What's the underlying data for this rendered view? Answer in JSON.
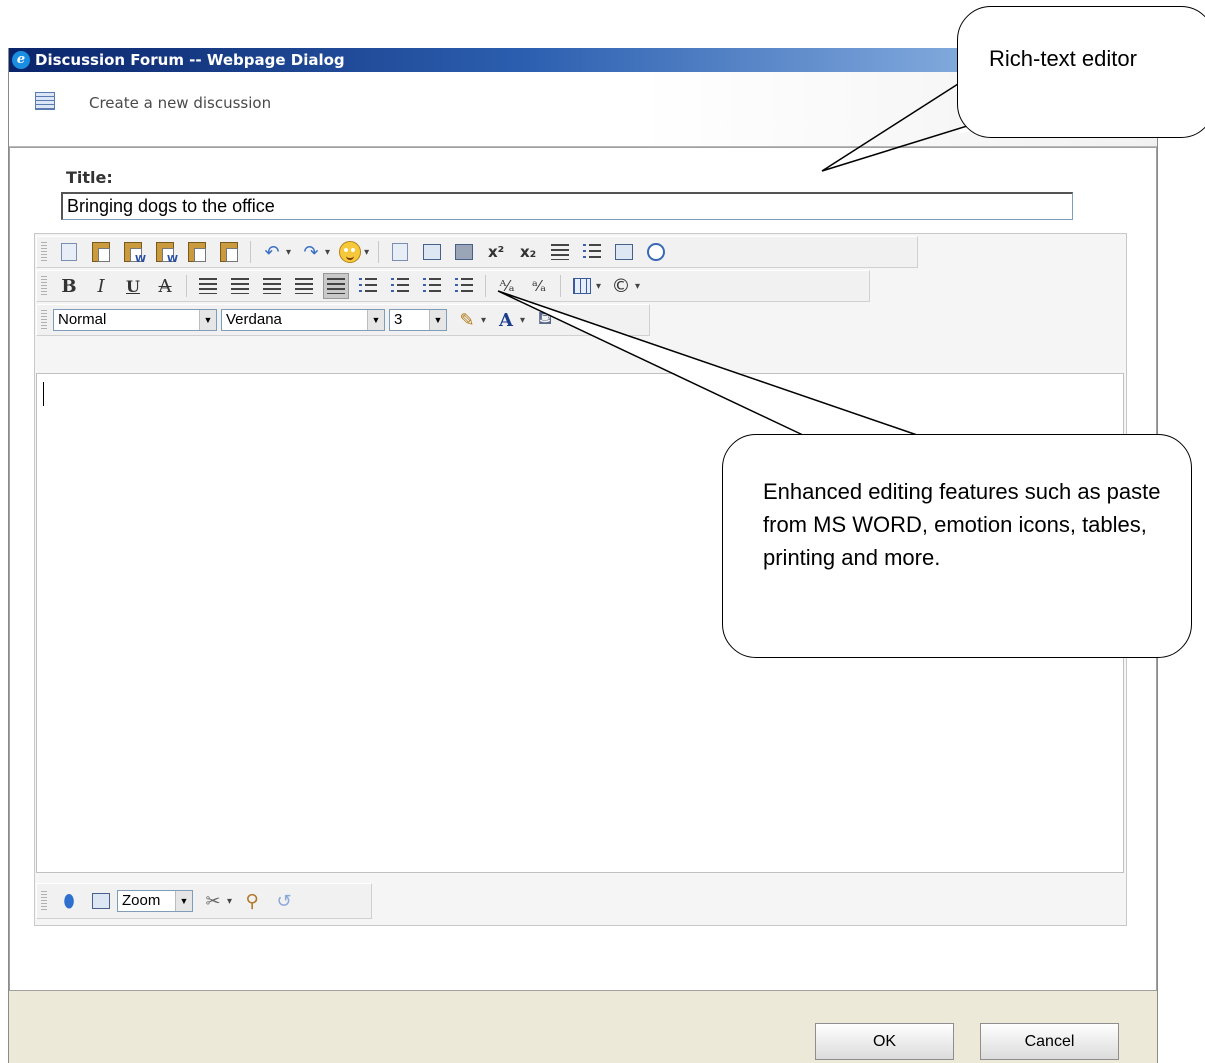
{
  "window": {
    "title": "Discussion Forum -- Webpage Dialog",
    "subheader": "Create a new discussion"
  },
  "form": {
    "title_label": "Title:",
    "title_value": "Bringing dogs to the office"
  },
  "toolbar": {
    "format_select": "Normal",
    "font_select": "Verdana",
    "size_select": "3",
    "zoom_select": "Zoom",
    "bold": "B",
    "italic": "I",
    "underline": "U",
    "strike": "A",
    "font_color": "A",
    "superscript": "x²",
    "subscript": "x₂"
  },
  "buttons": {
    "ok": "OK",
    "cancel": "Cancel"
  },
  "callouts": {
    "rich_text": "Rich-text editor",
    "features": "Enhanced editing features such as paste from MS WORD, emotion icons, tables, printing and more."
  },
  "colors": {
    "titlebar_start": "#0a246a",
    "titlebar_end": "#a6caf0",
    "dialog_bg": "#ece9d8"
  }
}
